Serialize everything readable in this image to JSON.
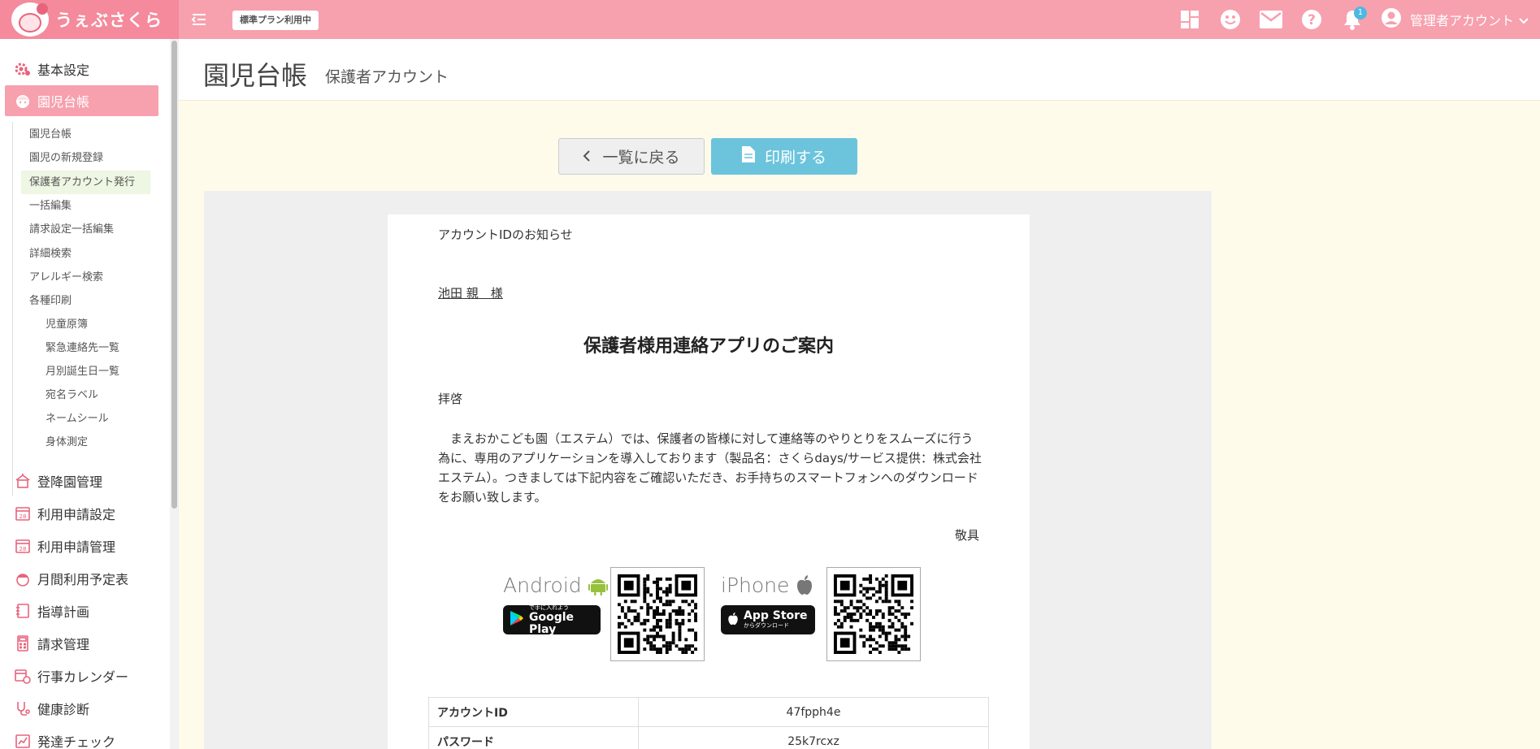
{
  "brand": {
    "name": "うぇぶさくら"
  },
  "header": {
    "plan_badge": "標準プラン利用中",
    "notification_count": "1",
    "admin_label": "管理者アカウント"
  },
  "sidebar": {
    "main_top": [
      {
        "label": "基本設定",
        "icon": "gear-icon"
      },
      {
        "label": "園児台帳",
        "icon": "child-face-icon"
      }
    ],
    "sub_items": [
      {
        "label": "園児台帳"
      },
      {
        "label": "園児の新規登録"
      },
      {
        "label": "保護者アカウント発行"
      },
      {
        "label": "一括編集"
      },
      {
        "label": "請求設定一括編集"
      },
      {
        "label": "詳細検索"
      },
      {
        "label": "アレルギー検索"
      },
      {
        "label": "各種印刷"
      }
    ],
    "print_items": [
      {
        "label": "児童原簿"
      },
      {
        "label": "緊急連絡先一覧"
      },
      {
        "label": "月別誕生日一覧"
      },
      {
        "label": "宛名ラベル"
      },
      {
        "label": "ネームシール"
      },
      {
        "label": "身体測定"
      }
    ],
    "main_bottom": [
      {
        "label": "登降園管理",
        "icon": "school-icon"
      },
      {
        "label": "利用申請設定",
        "icon": "calendar-icon"
      },
      {
        "label": "利用申請管理",
        "icon": "calendar-icon"
      },
      {
        "label": "月間利用予定表",
        "icon": "child-hat-icon"
      },
      {
        "label": "指導計画",
        "icon": "notebook-icon"
      },
      {
        "label": "請求管理",
        "icon": "calculator-icon"
      },
      {
        "label": "行事カレンダー",
        "icon": "calendar-clock-icon"
      },
      {
        "label": "健康診断",
        "icon": "stethoscope-icon"
      },
      {
        "label": "発達チェック",
        "icon": "chart-book-icon"
      }
    ],
    "active_color": "#f7a0ae"
  },
  "page": {
    "title": "園児台帳",
    "subtitle": "保護者アカウント"
  },
  "actions": {
    "back_label": "一覧に戻る",
    "print_label": "印刷する"
  },
  "letter": {
    "notice": "アカウントIDのお知らせ",
    "recipient": "池田 親　様",
    "heading": "保護者様用連絡アプリのご案内",
    "greeting": "拝啓",
    "body": "まえおかこども園（エステム）では、保護者の皆様に対して連絡等のやりとりをスムーズに行う為に、専用のアプリケーションを導入しております（製品名：さくらdays/サービス提供：株式会社エステム）。つきましては下記内容をご確認いただき、お手持ちのスマートフォンへのダウンロードをお願い致します。",
    "closing": "敬具",
    "android": {
      "name": "Android",
      "badge_main": "Google Play",
      "badge_sub": "で手に入れよう"
    },
    "iphone": {
      "name": "iPhone",
      "badge_main": "App Store",
      "badge_sub": "からダウンロード"
    },
    "account_rows": [
      {
        "key": "アカウントID",
        "value": "47fpph4e"
      },
      {
        "key": "パスワード",
        "value": "25k7rcxz"
      }
    ]
  },
  "colors": {
    "topbar": "#f7a0ae",
    "brand_bg": "#f48a9c",
    "print_button": "#6cc4dc",
    "content_bg": "#fffbeb"
  }
}
